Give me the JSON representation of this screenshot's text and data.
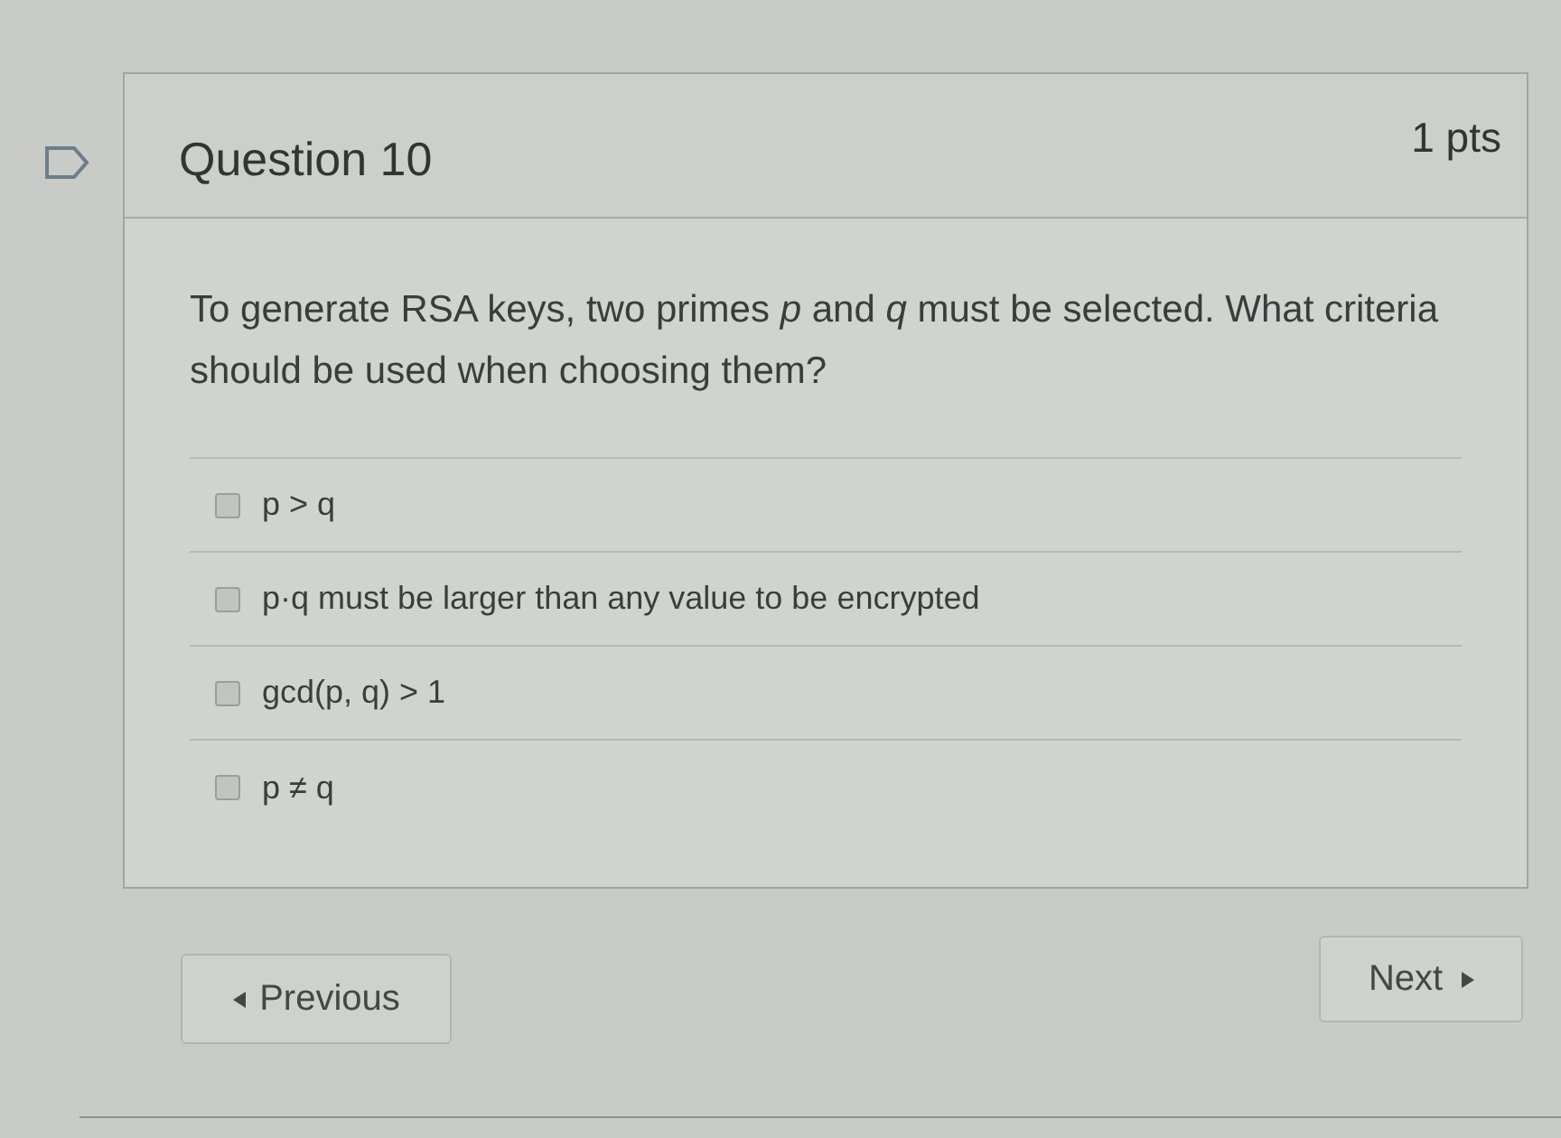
{
  "question": {
    "title": "Question 10",
    "points": "1 pts",
    "flagged": false,
    "text": "To generate RSA keys, two primes *p* and *q* must be selected. What criteria should be used when choosing them?"
  },
  "answers": [
    {
      "label": "p > q",
      "checked": false
    },
    {
      "label": "p·q must be larger than any value to be encrypted",
      "checked": false
    },
    {
      "label": "gcd(p, q) > 1",
      "checked": false
    },
    {
      "label": "p ≠ q",
      "checked": false
    }
  ],
  "navigation": {
    "previous": "Previous",
    "next": "Next"
  }
}
